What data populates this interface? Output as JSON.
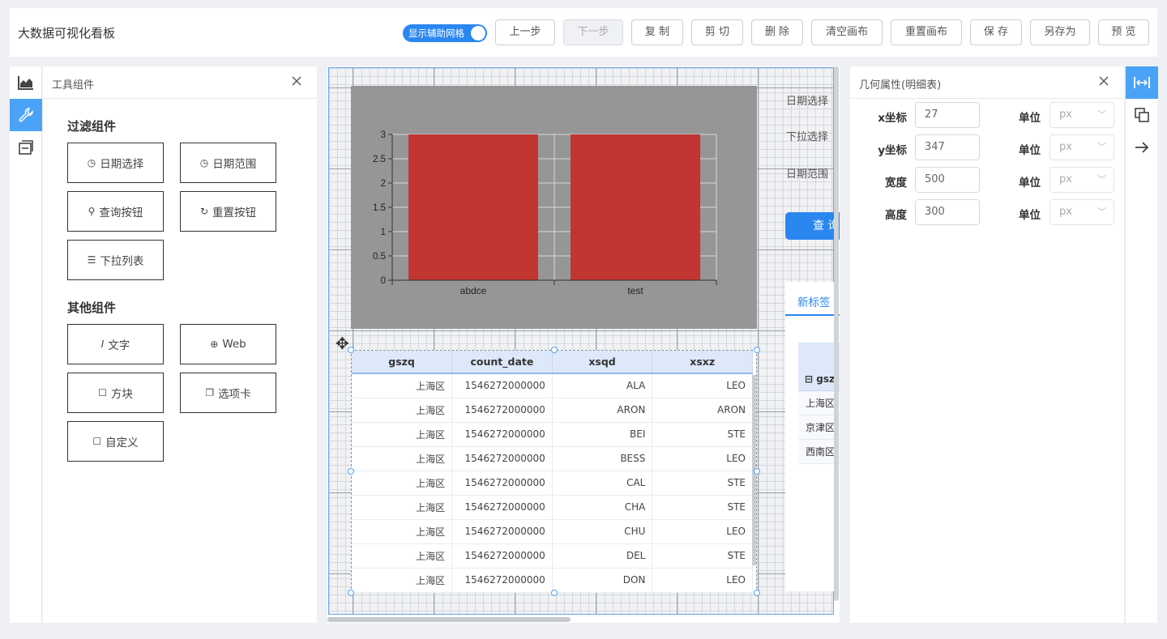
{
  "header": {
    "title": "大数据可视化看板",
    "grid_toggle_label": "显示辅助网格",
    "buttons": [
      "上一步",
      "下一步",
      "复 制",
      "剪 切",
      "删 除",
      "清空画布",
      "重置画布",
      "保 存",
      "另存为",
      "预 览"
    ]
  },
  "left_nav": {
    "icons": [
      "chart-icon",
      "wrench-icon",
      "layers-icon"
    ]
  },
  "tool_panel": {
    "title": "工具组件",
    "filter_section": "过滤组件",
    "filter_items": [
      "日期选择",
      "日期范围",
      "查询按钮",
      "重置按钮",
      "下拉列表"
    ],
    "other_section": "其他组件",
    "other_items": [
      "文字",
      "Web",
      "方块",
      "选项卡",
      "自定义"
    ]
  },
  "canvas": {
    "side_labels": [
      "日期选择",
      "下拉选择",
      "日期范围"
    ],
    "query_button": "查 询",
    "tab_label": "新标签",
    "pivot_header": "gsz",
    "pivot_rows": [
      "上海区",
      "京津区",
      "西南区"
    ]
  },
  "chart_data": {
    "type": "bar",
    "categories": [
      "abdce",
      "test"
    ],
    "values": [
      3,
      3
    ],
    "ylim": [
      0,
      3
    ],
    "yticks": [
      "0",
      "0.5",
      "1",
      "1.5",
      "2",
      "2.5",
      "3"
    ],
    "bar_color": "#c23531",
    "background": "#969696",
    "grid": true
  },
  "detail_table": {
    "columns": [
      "gszq",
      "count_date",
      "xsqd",
      "xsxz"
    ],
    "rows": [
      [
        "上海区",
        "1546272000000",
        "ALA",
        "LEO"
      ],
      [
        "上海区",
        "1546272000000",
        "ARON",
        "ARON"
      ],
      [
        "上海区",
        "1546272000000",
        "BEI",
        "STE"
      ],
      [
        "上海区",
        "1546272000000",
        "BESS",
        "LEO"
      ],
      [
        "上海区",
        "1546272000000",
        "CAL",
        "STE"
      ],
      [
        "上海区",
        "1546272000000",
        "CHA",
        "STE"
      ],
      [
        "上海区",
        "1546272000000",
        "CHU",
        "LEO"
      ],
      [
        "上海区",
        "1546272000000",
        "DEL",
        "STE"
      ],
      [
        "上海区",
        "1546272000000",
        "DON",
        "LEO"
      ]
    ]
  },
  "props_panel": {
    "title": "几何属性(明细表)",
    "fields": [
      {
        "label": "x坐标",
        "value": "27",
        "unit_label": "单位",
        "unit": "px"
      },
      {
        "label": "y坐标",
        "value": "347",
        "unit_label": "单位",
        "unit": "px"
      },
      {
        "label": "宽度",
        "value": "500",
        "unit_label": "单位",
        "unit": "px"
      },
      {
        "label": "高度",
        "value": "300",
        "unit_label": "单位",
        "unit": "px"
      }
    ]
  },
  "colors": {
    "accent": "#2b87f0",
    "nav_active": "#4aa3f7"
  }
}
